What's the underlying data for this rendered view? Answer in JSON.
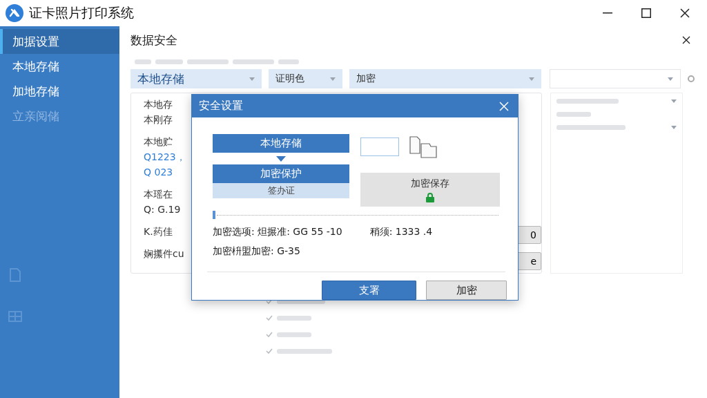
{
  "window": {
    "title": "证卡照片打印系统"
  },
  "sidebar": {
    "items": [
      {
        "label": "加据设置",
        "selected": true,
        "disabled": false
      },
      {
        "label": "本地存储",
        "selected": false,
        "disabled": false
      },
      {
        "label": "加地存储",
        "selected": false,
        "disabled": false
      },
      {
        "label": "立亲阅储",
        "selected": false,
        "disabled": true
      }
    ]
  },
  "panel": {
    "title": "数据安全",
    "toolbar": [
      {
        "value": "本地存储",
        "kind": "primary"
      },
      {
        "value": "证明色",
        "kind": "plain"
      },
      {
        "value": "加密",
        "kind": "plain"
      }
    ]
  },
  "card": {
    "groups": [
      [
        {
          "text": "本地存",
          "kind": "plain"
        },
        {
          "text": "本刚存",
          "kind": "plain"
        }
      ],
      [
        {
          "text": "本地贮",
          "kind": "plain"
        },
        {
          "text": "Q1223，",
          "kind": "link"
        },
        {
          "text": "Q 023",
          "kind": "link"
        }
      ],
      [
        {
          "text": "本瑶在",
          "kind": "plain"
        },
        {
          "text": "Q: G.19",
          "kind": "plain"
        }
      ],
      [
        {
          "text": "K.药佳",
          "kind": "plain"
        }
      ],
      [
        {
          "text": "娴攥件cu",
          "kind": "plain"
        }
      ]
    ],
    "buttons": [
      "0",
      "e"
    ]
  },
  "dialog": {
    "title": "安全设置",
    "source": "本地存储",
    "target": "加密保护",
    "target_sub": "签办证",
    "alt": "加密保存",
    "alt_locked": true,
    "lines": [
      {
        "label": "加密选项: 炟搌准: GG 55 -10",
        "extra": "稍须: 1333 .4"
      },
      {
        "label": "加密枡盟加密: G-35"
      }
    ],
    "buttons": [
      {
        "label": "支署",
        "primary": true
      },
      {
        "label": "加密",
        "primary": false
      }
    ]
  }
}
